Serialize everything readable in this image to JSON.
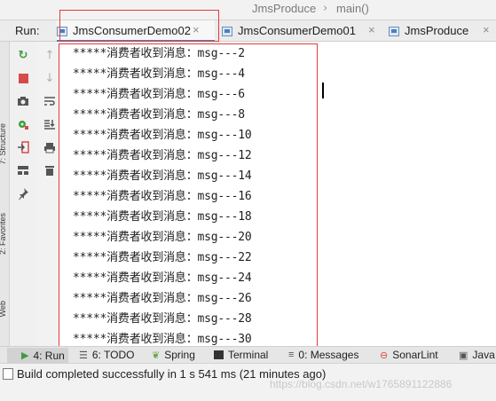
{
  "breadcrumb": {
    "class_name": "JmsProduce",
    "separator": "›",
    "method": "main()"
  },
  "run_panel": {
    "label": "Run:",
    "tabs": [
      {
        "label": "JmsConsumerDemo02",
        "close": "×",
        "active": true
      },
      {
        "label": "JmsConsumerDemo01",
        "close": "×",
        "active": false
      },
      {
        "label": "JmsProduce",
        "close": "×",
        "active": false
      }
    ]
  },
  "side_tabs": [
    "7: Structure",
    "2: Favorites",
    "Web"
  ],
  "toolbar_icons": {
    "rerun": "rerun-icon",
    "stop": "stop-icon",
    "camera": "camera-icon",
    "debug_settings": "settings-icon",
    "login": "login-icon",
    "layout": "layout-icon",
    "pin": "pin-icon",
    "up": "up-arrow-icon",
    "down": "down-arrow-icon",
    "soft_wrap": "soft-wrap-icon",
    "scroll_end": "scroll-to-end-icon",
    "print": "print-icon",
    "trash": "trash-icon"
  },
  "console": {
    "lines": [
      "*****消费者收到消息：msg---2",
      "*****消费者收到消息：msg---4",
      "*****消费者收到消息：msg---6",
      "*****消费者收到消息：msg---8",
      "*****消费者收到消息：msg---10",
      "*****消费者收到消息：msg---12",
      "*****消费者收到消息：msg---14",
      "*****消费者收到消息：msg---16",
      "*****消费者收到消息：msg---18",
      "*****消费者收到消息：msg---20",
      "*****消费者收到消息：msg---22",
      "*****消费者收到消息：msg---24",
      "*****消费者收到消息：msg---26",
      "*****消费者收到消息：msg---28",
      "*****消费者收到消息：msg---30"
    ]
  },
  "bottom_tools": [
    {
      "label": "4: Run",
      "icon": "run-icon",
      "active": true
    },
    {
      "label": "6: TODO",
      "icon": "todo-icon"
    },
    {
      "label": "Spring",
      "icon": "spring-icon"
    },
    {
      "label": "Terminal",
      "icon": "terminal-icon"
    },
    {
      "label": "0: Messages",
      "icon": "messages-icon"
    },
    {
      "label": "SonarLint",
      "icon": "sonarlint-icon"
    },
    {
      "label": "Java",
      "icon": "java-icon"
    }
  ],
  "status": {
    "message": "Build completed successfully in 1 s 541 ms (21 minutes ago)",
    "watermark": "https://blog.csdn.net/w1765891122886"
  },
  "colors": {
    "accent": "#4083c9",
    "annotation": "#e23b3b",
    "run_green": "#3e9c3e",
    "stop_red": "#d84a4a"
  }
}
